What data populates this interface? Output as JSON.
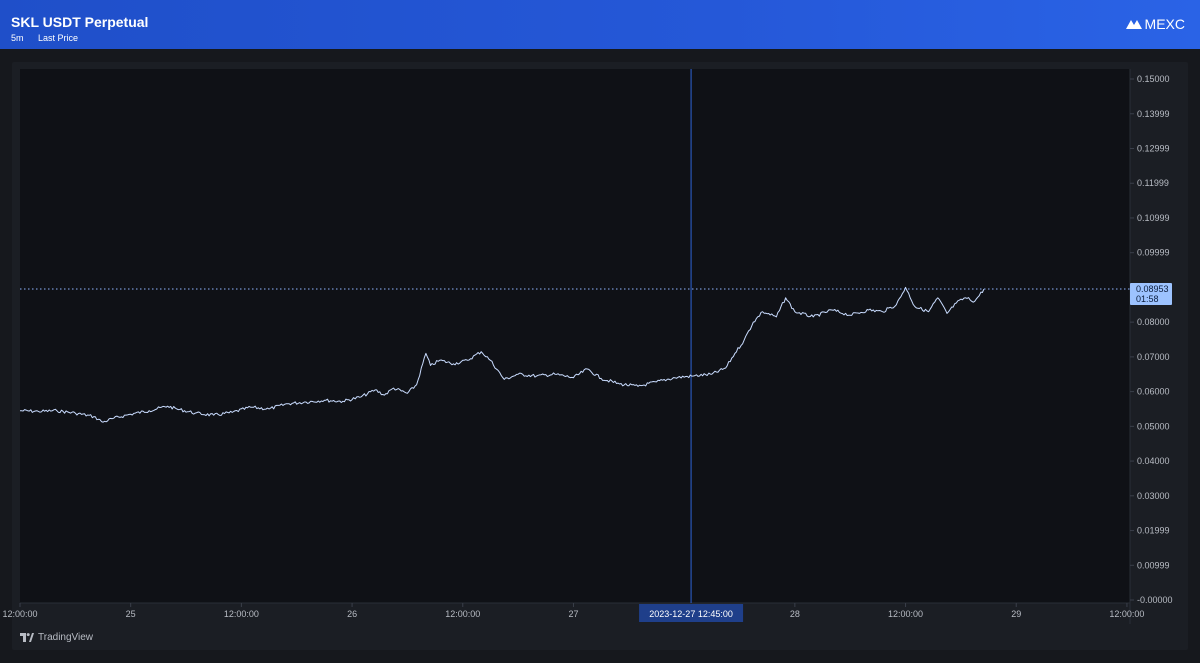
{
  "header": {
    "title": "SKL USDT Perpetual",
    "interval": "5m",
    "price_type": "Last Price",
    "logo_text": "MEXC"
  },
  "footer": {
    "brand": "TradingView"
  },
  "colors": {
    "header_bg": "#2558d8",
    "plot_bg": "#0f1116",
    "line": "#c9dcff",
    "crosshair": "#2f63d6",
    "price_tag": "#9dc3ff"
  },
  "chart_data": {
    "type": "line",
    "title": "",
    "ylim": [
      0,
      0.15
    ],
    "y_ticks": [
      "0.15000",
      "0.13999",
      "0.12999",
      "0.11999",
      "0.10999",
      "0.09999",
      "0.08000",
      "0.07000",
      "0.06000",
      "0.05000",
      "0.04000",
      "0.03000",
      "0.01999",
      "0.00999",
      "-0.00000"
    ],
    "y_tick_values": [
      0.15,
      0.13999,
      0.12999,
      0.11999,
      0.10999,
      0.09999,
      0.08,
      0.07,
      0.06,
      0.05,
      0.04,
      0.03,
      0.01999,
      0.00999,
      0
    ],
    "x_ticks": [
      "12:00:00",
      "25",
      "12:00:00",
      "26",
      "12:00:00",
      "27",
      "28",
      "12:00:00",
      "29",
      "12:00:00"
    ],
    "x_tick_times": [
      "2023-12-24 12:00",
      "2023-12-25 00:00",
      "2023-12-25 12:00",
      "2023-12-26 00:00",
      "2023-12-26 12:00",
      "2023-12-27 00:00",
      "2023-12-28 00:00",
      "2023-12-28 12:00",
      "2023-12-29 00:00",
      "2023-12-29 12:00"
    ],
    "x_range": [
      "2023-12-24 12:00",
      "2023-12-29 12:20"
    ],
    "last_price": {
      "value": 0.08953,
      "label": "0.08953",
      "countdown": "01:58"
    },
    "crosshair": {
      "time": "2023-12-27 12:45",
      "label": "2023-12-27   12:45:00"
    },
    "series": [
      {
        "points": [
          [
            "2023-12-24 12:00",
            0.0545
          ],
          [
            "2023-12-24 14:00",
            0.0543
          ],
          [
            "2023-12-24 16:00",
            0.0545
          ],
          [
            "2023-12-24 18:00",
            0.0538
          ],
          [
            "2023-12-24 20:00",
            0.0528
          ],
          [
            "2023-12-24 21:00",
            0.0512
          ],
          [
            "2023-12-24 22:00",
            0.0522
          ],
          [
            "2023-12-25 00:00",
            0.0535
          ],
          [
            "2023-12-25 02:00",
            0.0545
          ],
          [
            "2023-12-25 04:00",
            0.0558
          ],
          [
            "2023-12-25 05:00",
            0.055
          ],
          [
            "2023-12-25 07:00",
            0.0538
          ],
          [
            "2023-12-25 09:00",
            0.0532
          ],
          [
            "2023-12-25 11:00",
            0.054
          ],
          [
            "2023-12-25 13:00",
            0.0555
          ],
          [
            "2023-12-25 15:00",
            0.055
          ],
          [
            "2023-12-25 17:00",
            0.0565
          ],
          [
            "2023-12-25 19:00",
            0.057
          ],
          [
            "2023-12-25 21:00",
            0.0575
          ],
          [
            "2023-12-25 23:00",
            0.0572
          ],
          [
            "2023-12-26 01:00",
            0.0585
          ],
          [
            "2023-12-26 02:30",
            0.0605
          ],
          [
            "2023-12-26 03:30",
            0.059
          ],
          [
            "2023-12-26 04:30",
            0.061
          ],
          [
            "2023-12-26 06:00",
            0.0595
          ],
          [
            "2023-12-26 07:00",
            0.062
          ],
          [
            "2023-12-26 08:00",
            0.071
          ],
          [
            "2023-12-26 08:30",
            0.0675
          ],
          [
            "2023-12-26 09:30",
            0.069
          ],
          [
            "2023-12-26 11:00",
            0.068
          ],
          [
            "2023-12-26 12:30",
            0.069
          ],
          [
            "2023-12-26 14:00",
            0.0715
          ],
          [
            "2023-12-26 15:00",
            0.069
          ],
          [
            "2023-12-26 16:30",
            0.0635
          ],
          [
            "2023-12-26 18:00",
            0.065
          ],
          [
            "2023-12-26 20:00",
            0.0645
          ],
          [
            "2023-12-26 22:00",
            0.065
          ],
          [
            "2023-12-27 00:00",
            0.064
          ],
          [
            "2023-12-27 01:30",
            0.0665
          ],
          [
            "2023-12-27 03:00",
            0.0638
          ],
          [
            "2023-12-27 05:00",
            0.0622
          ],
          [
            "2023-12-27 07:00",
            0.0615
          ],
          [
            "2023-12-27 09:00",
            0.0628
          ],
          [
            "2023-12-27 11:00",
            0.064
          ],
          [
            "2023-12-27 13:00",
            0.0645
          ],
          [
            "2023-12-27 15:00",
            0.065
          ],
          [
            "2023-12-27 16:30",
            0.0668
          ],
          [
            "2023-12-27 17:30",
            0.071
          ],
          [
            "2023-12-27 18:30",
            0.0748
          ],
          [
            "2023-12-27 19:30",
            0.08
          ],
          [
            "2023-12-27 20:30",
            0.083
          ],
          [
            "2023-12-27 22:00",
            0.0815
          ],
          [
            "2023-12-27 23:00",
            0.087
          ],
          [
            "2023-12-28 00:00",
            0.083
          ],
          [
            "2023-12-28 02:00",
            0.0815
          ],
          [
            "2023-12-28 04:00",
            0.0835
          ],
          [
            "2023-12-28 06:00",
            0.082
          ],
          [
            "2023-12-28 08:00",
            0.0835
          ],
          [
            "2023-12-28 09:30",
            0.083
          ],
          [
            "2023-12-28 11:00",
            0.085
          ],
          [
            "2023-12-28 12:00",
            0.09
          ],
          [
            "2023-12-28 13:00",
            0.0845
          ],
          [
            "2023-12-28 14:30",
            0.083
          ],
          [
            "2023-12-28 15:30",
            0.087
          ],
          [
            "2023-12-28 16:30",
            0.0825
          ],
          [
            "2023-12-28 17:30",
            0.0855
          ],
          [
            "2023-12-28 18:30",
            0.087
          ],
          [
            "2023-12-28 19:30",
            0.086
          ],
          [
            "2023-12-28 20:30",
            0.0895
          ]
        ]
      }
    ]
  }
}
